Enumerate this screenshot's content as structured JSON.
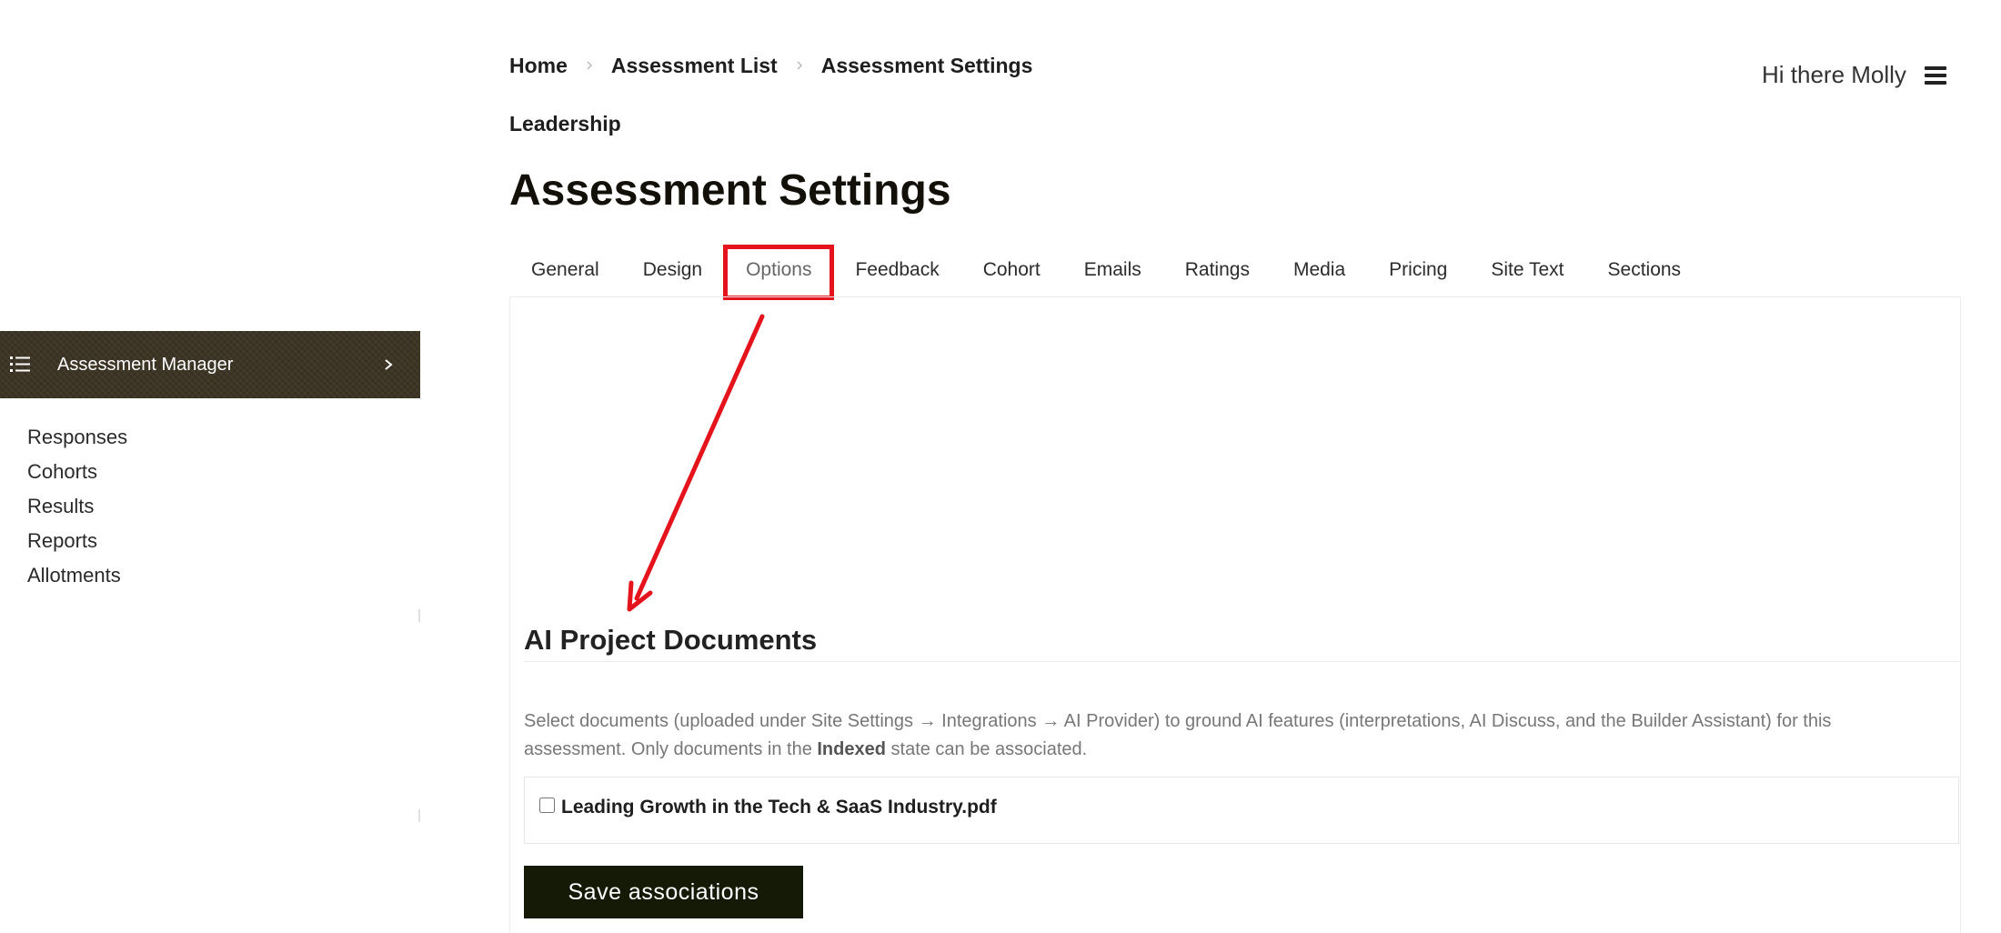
{
  "sidebar": {
    "header_label": "Assessment Manager",
    "header_icon": "list-icon",
    "items": [
      {
        "label": "Responses"
      },
      {
        "label": "Cohorts"
      },
      {
        "label": "Results"
      },
      {
        "label": "Reports"
      },
      {
        "label": "Allotments"
      }
    ]
  },
  "header": {
    "breadcrumb": [
      {
        "label": "Home"
      },
      {
        "label": "Assessment List"
      },
      {
        "label": "Assessment Settings"
      }
    ],
    "sub_crumb": "Leadership",
    "greeting": "Hi there Molly",
    "menu_icon": "hamburger-menu-icon"
  },
  "main": {
    "title": "Assessment Settings",
    "tabs": [
      {
        "label": "General"
      },
      {
        "label": "Design"
      },
      {
        "label": "Options",
        "active": true
      },
      {
        "label": "Feedback"
      },
      {
        "label": "Cohort"
      },
      {
        "label": "Emails"
      },
      {
        "label": "Ratings"
      },
      {
        "label": "Media"
      },
      {
        "label": "Pricing"
      },
      {
        "label": "Site Text"
      },
      {
        "label": "Sections"
      }
    ],
    "section": {
      "title": "AI Project Documents",
      "description_before": "Select documents (uploaded under Site Settings → Integrations → AI Provider) to ground AI features (interpretations, AI Discuss, and the Builder Assistant) for this assessment. Only documents in the ",
      "description_bold": "Indexed",
      "description_after": " state can be associated.",
      "documents": [
        {
          "name": "Leading Growth in the Tech & SaaS Industry.pdf",
          "checked": false
        }
      ],
      "save_label": "Save associations"
    }
  },
  "colors": {
    "sidebar_header_bg": "#3c3424",
    "save_button_bg": "#141a06",
    "annotation_red": "#e5131c"
  }
}
